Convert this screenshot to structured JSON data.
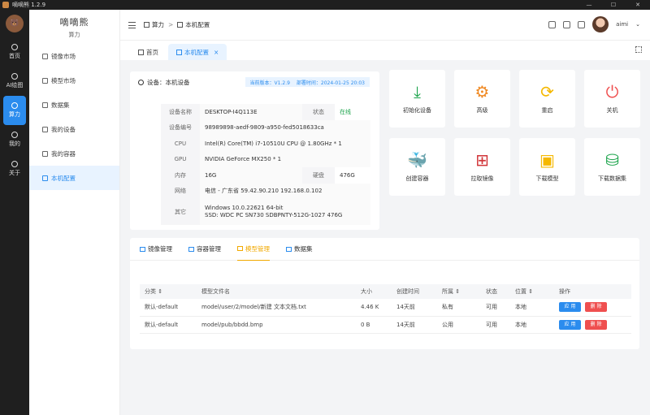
{
  "window": {
    "title": "嘀嘀熊 1.2.9",
    "controls": [
      "—",
      "☐",
      "✕"
    ]
  },
  "rail": {
    "logo": "🐻",
    "items": [
      {
        "label": "首页",
        "icon": "home-icon"
      },
      {
        "label": "AI绘图",
        "icon": "palette-icon"
      },
      {
        "label": "算力",
        "icon": "compute-icon",
        "active": true
      },
      {
        "label": "我的",
        "icon": "user-icon"
      },
      {
        "label": "关于",
        "icon": "about-icon"
      }
    ]
  },
  "sidebar": {
    "brand_title": "嘀嘀熊",
    "brand_sub": "算力",
    "items": [
      {
        "label": "镜像市场"
      },
      {
        "label": "模型市场"
      },
      {
        "label": "数据集"
      },
      {
        "label": "我的设备"
      },
      {
        "label": "我的容器"
      },
      {
        "label": "本机配置",
        "active": true
      }
    ]
  },
  "header": {
    "breadcrumb": [
      "算力",
      "本机配置"
    ],
    "sep": ">",
    "user": "aimi"
  },
  "tabs": [
    {
      "label": "首页"
    },
    {
      "label": "本机配置",
      "active": true,
      "close": "×"
    }
  ],
  "device": {
    "title": "设备：本机设备",
    "version": "当前版本：V1.2.9",
    "deploy": "部署时间：2024-01-25 20:03",
    "rows": [
      {
        "k": "设备名称",
        "v": "DESKTOP-I4Q113E",
        "k2": "状态",
        "v2": "在线"
      },
      {
        "k": "设备编号",
        "v": "98989898-aedf-9809-a950-fed5018633ca"
      },
      {
        "k": "CPU",
        "v": "Intel(R) Core(TM) i7-10510U CPU @ 1.80GHz * 1"
      },
      {
        "k": "GPU",
        "v": "NVIDIA GeForce MX250 * 1"
      },
      {
        "k": "内存",
        "v": "16G",
        "k2": "硬盘",
        "v2": "476G"
      },
      {
        "k": "网络",
        "v": "电信 - 广东省 59.42.90.210 192.168.0.102"
      },
      {
        "k": "其它",
        "v": "Windows 10.0.22621 64-bit",
        "v_line2": "SSD: WDC PC SN730 SDBPNTY-512G-1027 476G"
      }
    ]
  },
  "actions": [
    {
      "label": "初始化设备",
      "glyph": "⤓",
      "color": "#1aa34a"
    },
    {
      "label": "高级",
      "glyph": "⚙",
      "color": "#f08a24"
    },
    {
      "label": "重启",
      "glyph": "⟳",
      "color": "#f5b800"
    },
    {
      "label": "关机",
      "glyph": "⏻",
      "color": "#ef4f4f"
    },
    {
      "label": "创建容器",
      "glyph": "🐳",
      "color": "#555555"
    },
    {
      "label": "拉取镜像",
      "glyph": "⊞",
      "color": "#d13438"
    },
    {
      "label": "下载模型",
      "glyph": "▣",
      "color": "#f5b800"
    },
    {
      "label": "下载数据集",
      "glyph": "⛁",
      "color": "#1aa34a"
    }
  ],
  "table_tabs": [
    "镜像管理",
    "容器管理",
    "模型管理",
    "数据集"
  ],
  "table": {
    "headers": [
      "分类 ⇕",
      "模型文件名",
      "大小",
      "创建时间",
      "所属 ⇕",
      "状态",
      "位置 ⇕",
      "操作"
    ],
    "rows": [
      [
        "默认-default",
        "model/user/2/model/新建 文本文档.txt",
        "4.46 K",
        "14天前",
        "私有",
        "可用",
        "本地"
      ],
      [
        "默认-default",
        "model/pub/bbdd.bmp",
        "0 B",
        "14天前",
        "公用",
        "可用",
        "本地"
      ]
    ],
    "use_label": "应 用",
    "del_label": "删 除"
  }
}
